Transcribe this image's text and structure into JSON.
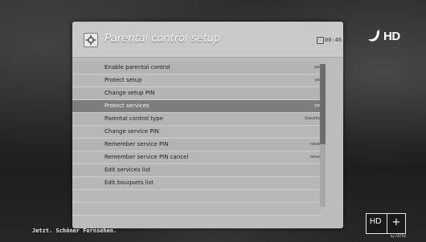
{
  "header": {
    "title": "Parental control setup",
    "clock": "00:46"
  },
  "menu": {
    "items": [
      {
        "label": "Enable parental control",
        "value": "yes",
        "selected": false
      },
      {
        "label": "Protect setup",
        "value": "yes",
        "selected": false
      },
      {
        "label": "Change setup PIN",
        "value": "",
        "selected": false
      },
      {
        "label": "Protect services",
        "value": "yes",
        "selected": true
      },
      {
        "label": "Parental control type",
        "value": "blacklist",
        "selected": false
      },
      {
        "label": "Change service PIN",
        "value": "",
        "selected": false
      },
      {
        "label": "Remember service PIN",
        "value": "never",
        "selected": false
      },
      {
        "label": "Remember service PIN cancel",
        "value": "never",
        "selected": false
      },
      {
        "label": "Edit services list",
        "value": "",
        "selected": false
      },
      {
        "label": "Edit bouquets list",
        "value": "",
        "selected": false
      }
    ]
  },
  "branding": {
    "channel_logo": "HD",
    "tagline": "Jetzt. Schöner Fernsehen.",
    "hdplus": {
      "hd": "HD",
      "plus": "+",
      "sub": "by ASTRA"
    }
  },
  "colors": {
    "panel": "#bcbcbc",
    "selected_row": "#7d7d7d",
    "scroll_thumb": "#6c6c6c"
  }
}
